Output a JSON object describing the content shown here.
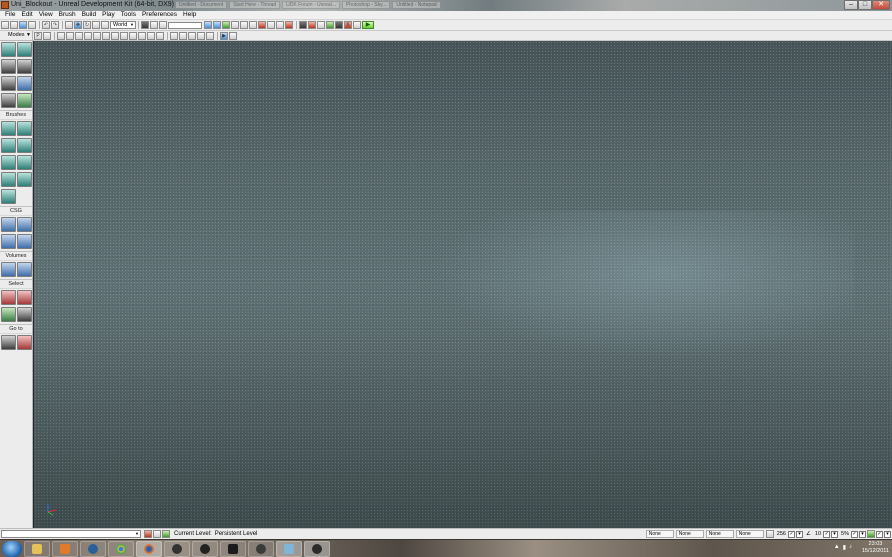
{
  "window": {
    "title": "Uni_Blockout - Unreal Development Kit (64-bit, DX9)",
    "background_tabs": [
      "Untitled - Document",
      "Start Here - Thread",
      "UDK Forum - Unreal...",
      "Photoshop - Sky...",
      "Untitled - Notepad"
    ]
  },
  "menu": [
    "File",
    "Edit",
    "View",
    "Brush",
    "Build",
    "Play",
    "Tools",
    "Preferences",
    "Help"
  ],
  "toolbar": {
    "coord_system": "World"
  },
  "modes_panel": {
    "header": "Modes",
    "sections": [
      "Brushes",
      "CSG",
      "Volumes",
      "Select",
      "Go to"
    ]
  },
  "status": {
    "current_level_label": "Current Level:",
    "current_level_value": "Persistent Level",
    "fields": [
      "None",
      "None",
      "None",
      "None"
    ],
    "grid_size": "256",
    "rotation_snap": "10",
    "scale_snap": "5%"
  },
  "taskbar": {
    "time": "23:03",
    "date": "15/12/2011",
    "apps": [
      "explorer",
      "media-player",
      "steam",
      "chrome",
      "firefox",
      "steam-alt",
      "app-g",
      "app-s",
      "udk",
      "photoshop",
      "udk"
    ]
  },
  "colors": {
    "floor": "#56676a",
    "ui_panel": "#ececec",
    "taskbar": "#6a5f55"
  }
}
